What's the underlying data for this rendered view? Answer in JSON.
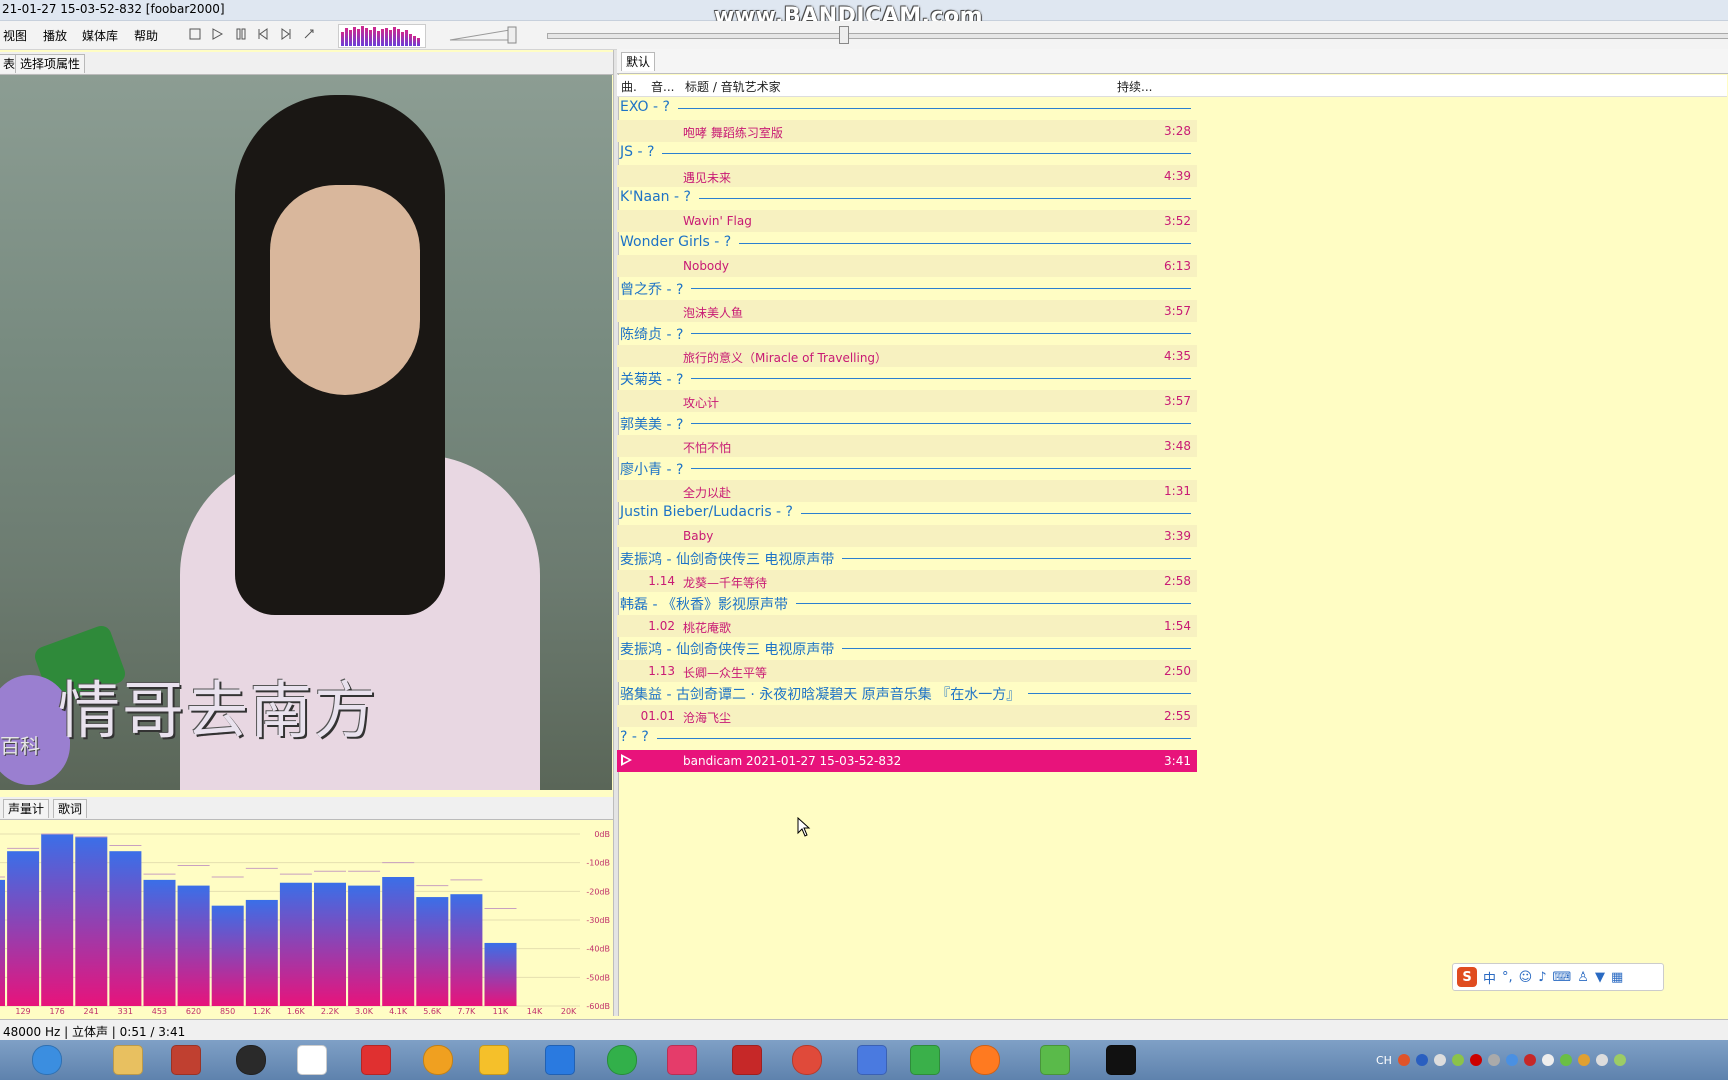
{
  "window": {
    "title": "21-01-27 15-03-52-832  [foobar2000]"
  },
  "watermark": "www.BANDICAM.com",
  "menu": [
    {
      "label": "视图"
    },
    {
      "label": "播放"
    },
    {
      "label": "媒体库"
    },
    {
      "label": "帮助"
    }
  ],
  "left_tabs": {
    "partial": "表",
    "selection_props": "选择项属性"
  },
  "video": {
    "subtitle": "情哥去南方",
    "watermark_text": "百科"
  },
  "bottom_tabs": {
    "meter": "声量计",
    "lyrics": "歌词"
  },
  "playlist_tab": "默认",
  "columns": {
    "c1": "曲.",
    "c2": "音...",
    "c3": "标题 / 音轨艺术家",
    "c4": "持续..."
  },
  "groups": [
    {
      "label": "EXO - ?",
      "tracks": [
        {
          "num": "",
          "title": "咆哮 舞蹈练习室版",
          "duration": "3:28"
        }
      ]
    },
    {
      "label": "JS - ?",
      "tracks": [
        {
          "num": "",
          "title": "遇见未来",
          "duration": "4:39"
        }
      ]
    },
    {
      "label": "K'Naan - ?",
      "tracks": [
        {
          "num": "",
          "title": "Wavin' Flag",
          "duration": "3:52"
        }
      ]
    },
    {
      "label": "Wonder Girls - ?",
      "tracks": [
        {
          "num": "",
          "title": "Nobody",
          "duration": "6:13"
        }
      ]
    },
    {
      "label": "曾之乔 - ?",
      "tracks": [
        {
          "num": "",
          "title": "泡沫美人鱼",
          "duration": "3:57"
        }
      ]
    },
    {
      "label": "陈绮贞 - ?",
      "tracks": [
        {
          "num": "",
          "title": "旅行的意义（Miracle of Travelling）",
          "duration": "4:35"
        }
      ]
    },
    {
      "label": "关菊英 - ?",
      "tracks": [
        {
          "num": "",
          "title": "攻心计",
          "duration": "3:57"
        }
      ]
    },
    {
      "label": "郭美美 - ?",
      "tracks": [
        {
          "num": "",
          "title": "不怕不怕",
          "duration": "3:48"
        }
      ]
    },
    {
      "label": "廖小青 - ?",
      "tracks": [
        {
          "num": "",
          "title": "全力以赴",
          "duration": "1:31"
        }
      ]
    },
    {
      "label": "Justin Bieber/Ludacris - ?",
      "tracks": [
        {
          "num": "",
          "title": "Baby",
          "duration": "3:39"
        }
      ]
    },
    {
      "label": "麦振鸿 - 仙剑奇侠传三 电视原声带",
      "tracks": [
        {
          "num": "1.14",
          "title": "龙葵—千年等待",
          "duration": "2:58"
        }
      ]
    },
    {
      "label": "韩磊 - 《秋香》影视原声带",
      "tracks": [
        {
          "num": "1.02",
          "title": "桃花庵歌",
          "duration": "1:54"
        }
      ]
    },
    {
      "label": "麦振鸿 - 仙剑奇侠传三 电视原声带",
      "tracks": [
        {
          "num": "1.13",
          "title": "长卿—众生平等",
          "duration": "2:50"
        }
      ]
    },
    {
      "label": "骆集益 - 古剑奇谭二 · 永夜初晗凝碧天 原声音乐集 『在水一方』",
      "tracks": [
        {
          "num": "01.01",
          "title": "沧海飞尘",
          "duration": "2:55"
        }
      ]
    },
    {
      "label": "? - ?",
      "tracks": [
        {
          "num": "",
          "title": "bandicam 2021-01-27 15-03-52-832",
          "duration": "3:41",
          "playing": true
        }
      ]
    }
  ],
  "spectrum": {
    "x_labels": [
      "129",
      "176",
      "241",
      "331",
      "453",
      "620",
      "850",
      "1.2K",
      "1.6K",
      "2.2K",
      "3.0K",
      "4.1K",
      "5.6K",
      "7.7K",
      "11K",
      "14K",
      "20K"
    ],
    "y_labels": [
      "0dB",
      "-10dB",
      "-20dB",
      "-30dB",
      "-40dB",
      "-50dB",
      "-60dB"
    ],
    "bars_db": [
      -16,
      -6,
      0,
      -1,
      -6,
      -16,
      -18,
      -25,
      -23,
      -17,
      -17,
      -18,
      -15,
      -22,
      -21,
      -38,
      -60
    ],
    "peaks_db": [
      -15,
      -5,
      0,
      -1,
      -4,
      -14,
      -11,
      -15,
      -12,
      -14,
      -13,
      -13,
      -10,
      -18,
      -16,
      -26,
      -60
    ],
    "colors": {
      "top": "#3a6fe8",
      "bottom": "#e8137b"
    }
  },
  "ime_bar": {
    "logo": "S",
    "mode": "中"
  },
  "status": "48000 Hz | 立体声 | 0:51 / 3:41",
  "taskbar": {
    "icons": [
      "search-icon",
      "file-explorer-icon",
      "video-player-icon",
      "headphones-icon",
      "alien-app-icon",
      "netease-music-icon",
      "browser-icon",
      "potplayer-icon",
      "app-1-icon",
      "iqiyi-icon",
      "youku-icon",
      "flash-icon",
      "chrome-icon",
      "bird-app-icon",
      "media-icon",
      "firefox-icon",
      "refresh-app-icon",
      "record-icon"
    ],
    "tray_text": "CH"
  }
}
